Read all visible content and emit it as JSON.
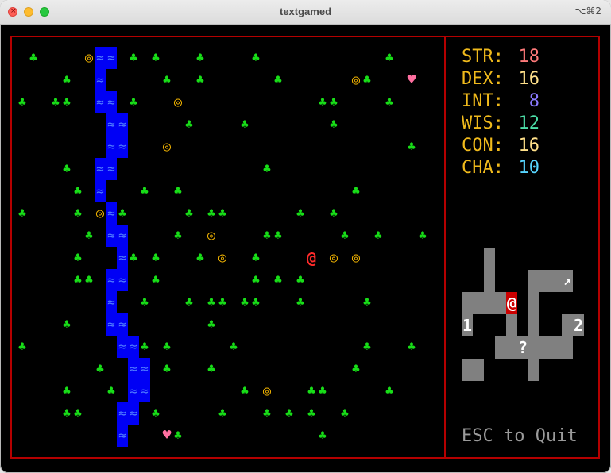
{
  "window": {
    "title": "textgamed",
    "shortcut": "⌥⌘2"
  },
  "stats": [
    {
      "name": "STR:",
      "value": "18",
      "color": "#ff7a7a"
    },
    {
      "name": "DEX:",
      "value": "16",
      "color": "#ffe08a"
    },
    {
      "name": "INT:",
      "value": "8",
      "color": "#8a7aff"
    },
    {
      "name": "WIS:",
      "value": "12",
      "color": "#4cdfa8"
    },
    {
      "name": "CON:",
      "value": "16",
      "color": "#ffe08a"
    },
    {
      "name": "CHA:",
      "value": "10",
      "color": "#57d5ff"
    }
  ],
  "map": {
    "player": "@",
    "tree_glyph": "♣",
    "gold_glyph": "◎",
    "heart_glyph": "♥",
    "water_glyph": "≈"
  },
  "minimap": {
    "player": "@",
    "label_1": "1",
    "label_2": "2",
    "unknown": "?",
    "exit_arrow": "↗"
  },
  "footer": {
    "quit_label": "ESC to Quit"
  }
}
